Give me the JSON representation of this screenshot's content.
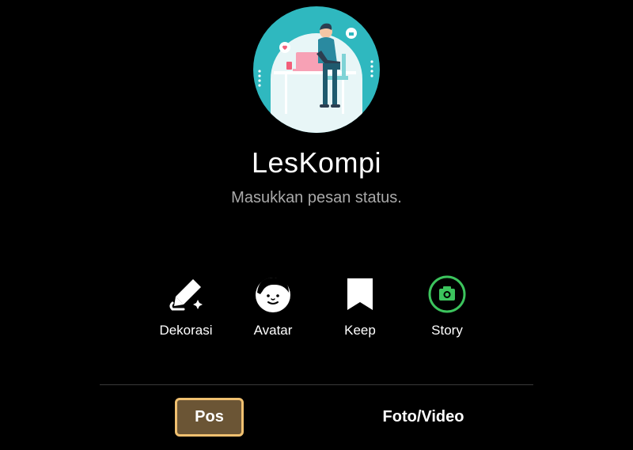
{
  "profile": {
    "name": "LesKompi",
    "status_placeholder": "Masukkan pesan status."
  },
  "actions": [
    {
      "label": "Dekorasi",
      "icon": "decorate-pen-icon"
    },
    {
      "label": "Avatar",
      "icon": "avatar-face-icon"
    },
    {
      "label": "Keep",
      "icon": "bookmark-icon"
    },
    {
      "label": "Story",
      "icon": "camera-icon"
    }
  ],
  "tabs": {
    "pos_label": "Pos",
    "foto_video_label": "Foto/Video"
  },
  "colors": {
    "background": "#000000",
    "avatar_bg": "#2fb8bf",
    "story_accent": "#3cc45d",
    "pos_tab_fill": "#6b5535",
    "pos_tab_border": "#f0c070",
    "status_text": "#a9a9a9"
  }
}
